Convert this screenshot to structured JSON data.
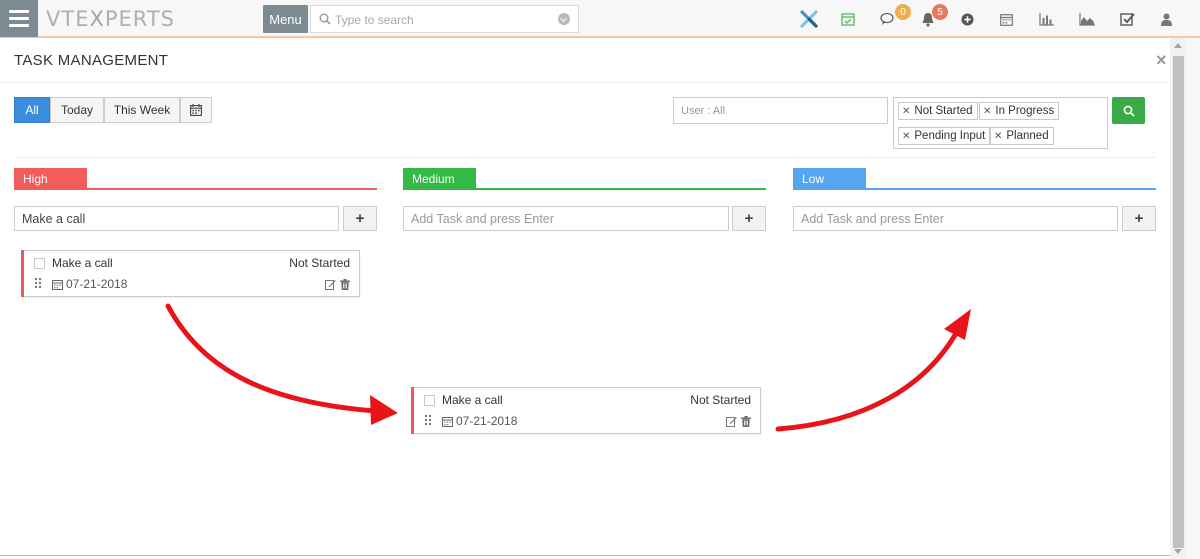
{
  "header": {
    "logo_text": "VTEXPERTS",
    "menu_label": "Menu",
    "search_placeholder": "Type to search",
    "icons": [
      "vtiger-x-icon",
      "calendar-check-icon",
      "chat-icon",
      "bell-icon",
      "plus-circle-icon",
      "calendar-icon",
      "bar-chart-icon",
      "area-chart-icon",
      "tasks-icon",
      "user-icon"
    ],
    "chat_badge": "0",
    "bell_badge": "5",
    "chat_badge_color": "#f0ad4e",
    "bell_badge_color": "#e8795a"
  },
  "panel": {
    "title": "TASK MANAGEMENT",
    "close": "×"
  },
  "filters": {
    "ranges": [
      "All",
      "Today",
      "This Week"
    ],
    "active_range": "All",
    "user_placeholder": "User : All",
    "statuses": [
      "Not Started",
      "In Progress",
      "Pending Input",
      "Planned"
    ]
  },
  "columns": [
    {
      "label": "High",
      "color": "#f45b5b",
      "input_value": "Make a call",
      "input_placeholder": "Add Task and press Enter"
    },
    {
      "label": "Medium",
      "color": "#33b945",
      "input_value": "",
      "input_placeholder": "Add Task and press Enter"
    },
    {
      "label": "Low",
      "color": "#55a6ef",
      "input_value": "",
      "input_placeholder": "Add Task and press Enter"
    }
  ],
  "cards": [
    {
      "name": "Make a call",
      "status": "Not Started",
      "date": "07-21-2018"
    },
    {
      "name": "Make a call",
      "status": "Not Started",
      "date": "07-21-2018"
    }
  ],
  "colors": {
    "accent_blue": "#3c8dde",
    "search_green": "#3aaa47",
    "arrow_red": "#e8141a",
    "priority_high": "#ee5a5a"
  }
}
